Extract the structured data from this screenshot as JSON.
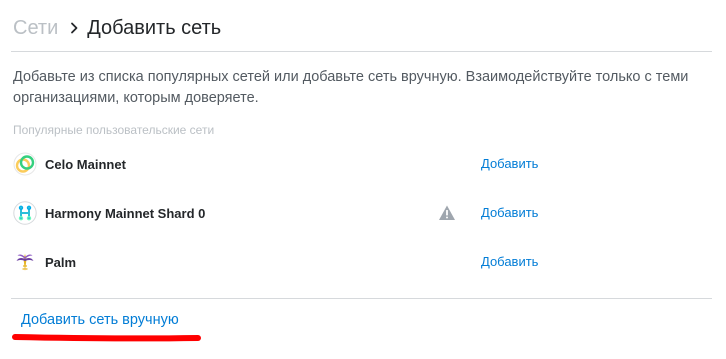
{
  "header": {
    "breadcrumb_root": "Сети",
    "title": "Добавить сеть"
  },
  "description": "Добавьте из списка популярных сетей или добавьте сеть вручную. Взаимодействуйте только с теми организациями, которым доверяете.",
  "section_label": "Популярные пользовательские сети",
  "networks": [
    {
      "name": "Celo Mainnet",
      "icon": "celo-icon",
      "add_label": "Добавить",
      "warning": false
    },
    {
      "name": "Harmony Mainnet Shard 0",
      "icon": "harmony-icon",
      "add_label": "Добавить",
      "warning": true
    },
    {
      "name": "Palm",
      "icon": "palm-icon",
      "add_label": "Добавить",
      "warning": false
    }
  ],
  "manual_link": "Добавить сеть вручную",
  "colors": {
    "link": "#037dd6",
    "muted": "#bbc0c5",
    "annotation": "#ff0000"
  }
}
